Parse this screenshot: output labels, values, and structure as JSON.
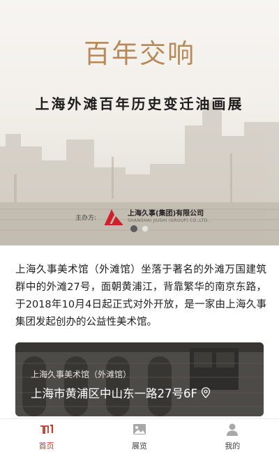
{
  "banner": {
    "logo_text": "百年交响",
    "title": "上海外滩百年历史变迁油画展",
    "sponsor_label": "主办方:",
    "sponsor_name_cn": "上海久事(集团)有限公司",
    "sponsor_name_en": "SHANGHAI JIUSHI (GROUP) CO.,LTD.",
    "carousel": {
      "total": 2,
      "active_index": 0
    }
  },
  "intro": {
    "text": "上海久事美术馆（外滩馆）坐落于著名的外滩万国建筑群中的外滩27号，面朝黄浦江，背靠繁华的南京东路，于2018年10月4日起正式对外开放，是一家由上海久事集团发起创办的公益性美术馆。"
  },
  "location_card": {
    "subtitle": "上海久事美术馆（外滩馆）",
    "address": "上海市黄浦区中山东一路27号6F",
    "icon": "location-pin-icon"
  },
  "bottom_nav": {
    "items": [
      {
        "label": "首页",
        "icon": "home-icon",
        "active": true
      },
      {
        "label": "展览",
        "icon": "image-icon",
        "active": false
      },
      {
        "label": "我的",
        "icon": "user-icon",
        "active": false
      }
    ],
    "active_color": "#c0392b",
    "inactive_color": "#9a9a9a"
  },
  "colors": {
    "logo_gold": "#b88a5a",
    "sponsor_red": "#d0202a"
  }
}
